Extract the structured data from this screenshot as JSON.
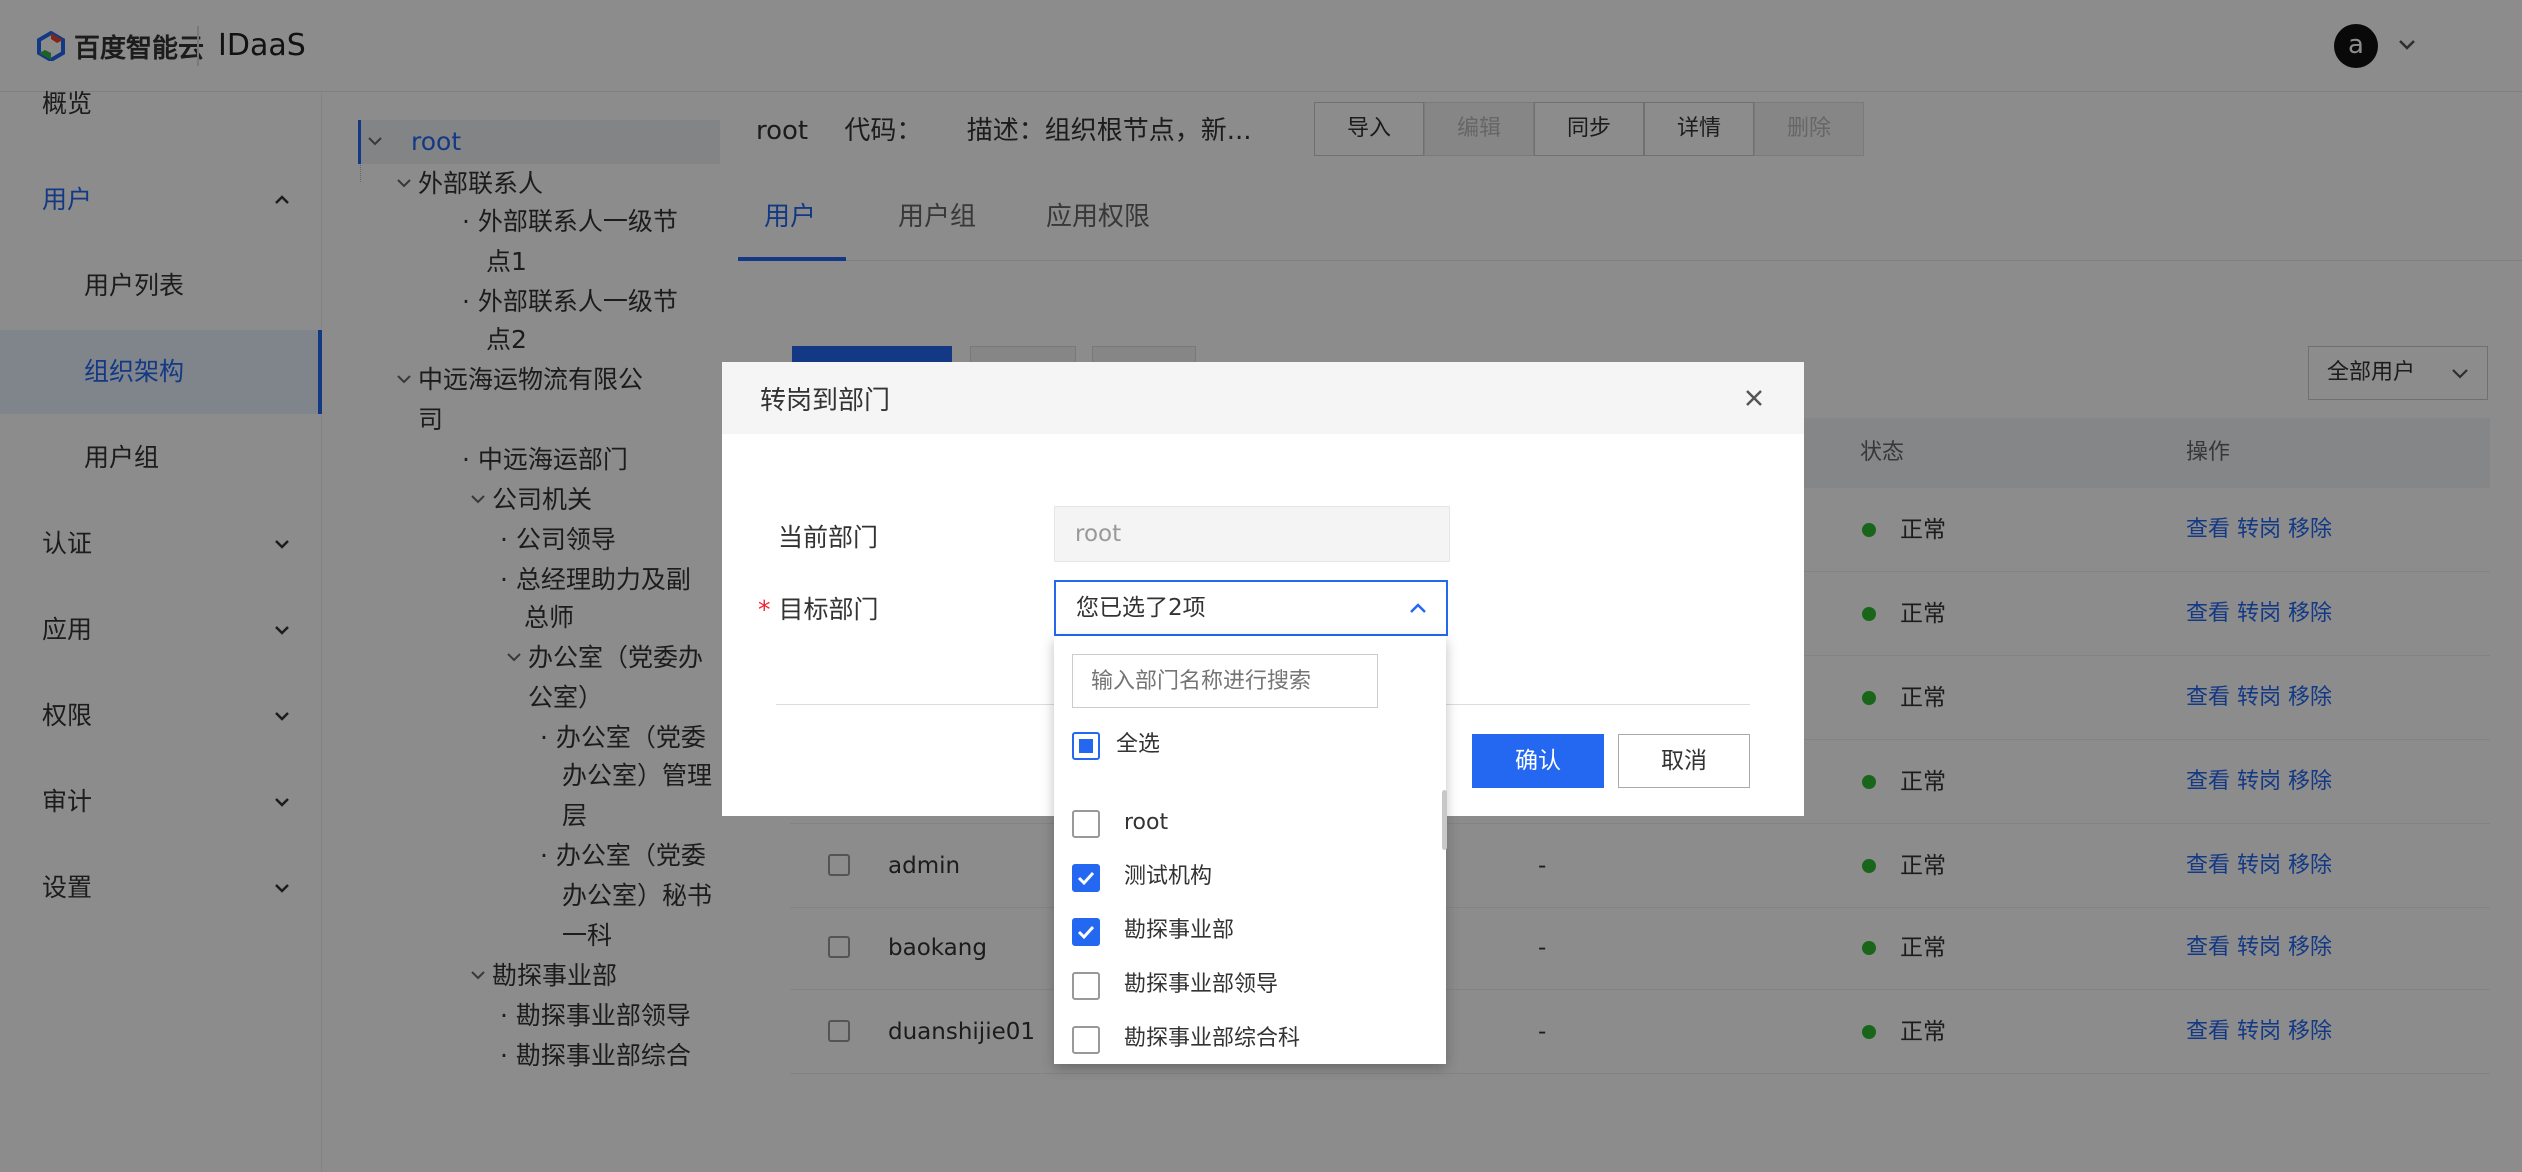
{
  "header": {
    "brand_text": "百度智能云",
    "app_name": "IDaaS",
    "avatar_letter": "a"
  },
  "sidebar": {
    "items": [
      {
        "label": "概览"
      },
      {
        "label": "用户"
      },
      {
        "label": "用户列表"
      },
      {
        "label": "组织架构"
      },
      {
        "label": "用户组"
      },
      {
        "label": "认证"
      },
      {
        "label": "应用"
      },
      {
        "label": "权限"
      },
      {
        "label": "审计"
      },
      {
        "label": "设置"
      }
    ]
  },
  "tree": {
    "nodes": [
      "root",
      "外部联系人",
      "外部联系人一级节",
      "点1",
      "外部联系人一级节",
      "点2",
      "中远海运物流有限公",
      "司",
      "中远海运部门",
      "公司机关",
      "公司领导",
      "总经理助力及副",
      "总师",
      "办公室（党委办",
      "公室）",
      "办公室（党委",
      "办公室）管理",
      "层",
      "办公室（党委",
      "办公室）秘书",
      "一科",
      "勘探事业部",
      "勘探事业部领导",
      "勘探事业部综合"
    ]
  },
  "main": {
    "node_name": "root",
    "code_label": "代码：",
    "desc_label": "描述：组织根节点，新...",
    "actions": [
      "导入",
      "编辑",
      "同步",
      "详情",
      "删除"
    ],
    "tabs": [
      "用户",
      "用户组",
      "应用权限"
    ],
    "filter_value": "全部用户",
    "columns": {
      "status": "状态",
      "ops": "操作"
    },
    "rows": [
      {
        "name": "",
        "dept": "",
        "status": "正常"
      },
      {
        "name": "",
        "dept": "",
        "status": "正常"
      },
      {
        "name": "",
        "dept": "",
        "status": "正常"
      },
      {
        "name": "",
        "dept": "",
        "status": "正常"
      },
      {
        "name": "admin",
        "dept": "-",
        "status": "正常"
      },
      {
        "name": "baokang",
        "dept": "-",
        "status": "正常"
      },
      {
        "name": "duanshijie01",
        "dept": "-",
        "status": "正常"
      }
    ],
    "op_view": "查看",
    "op_transfer": "转岗",
    "op_remove": "移除"
  },
  "modal": {
    "title": "转岗到部门",
    "current_label": "当前部门",
    "current_value": "root",
    "target_required": "*",
    "target_label": "目标部门",
    "target_value": "您已选了2项",
    "ok": "确认",
    "cancel": "取消"
  },
  "dropdown": {
    "search_placeholder": "输入部门名称进行搜索",
    "select_all": "全选",
    "options": [
      {
        "label": "root",
        "checked": false
      },
      {
        "label": "测试机构",
        "checked": true
      },
      {
        "label": "勘探事业部",
        "checked": true
      },
      {
        "label": "勘探事业部领导",
        "checked": false
      },
      {
        "label": "勘探事业部综合科",
        "checked": false
      }
    ]
  },
  "colors": {
    "accent": "#2468f2",
    "status_ok": "#2eb82e"
  }
}
